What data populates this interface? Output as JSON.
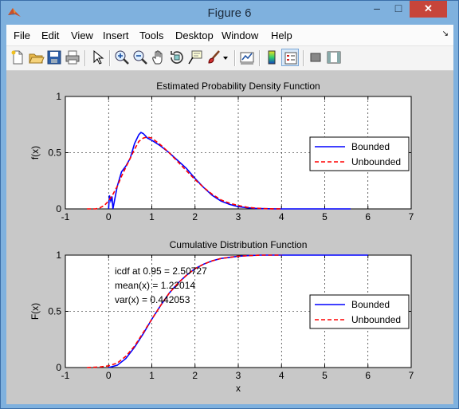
{
  "window": {
    "title": "Figure 6",
    "min_label": "–",
    "max_label": "□",
    "close_label": "✕"
  },
  "menu": [
    "File",
    "Edit",
    "View",
    "Insert",
    "Tools",
    "Desktop",
    "Window",
    "Help"
  ],
  "dock_glyph": "↘",
  "toolbar": [
    "new-figure-icon",
    "open-file-icon",
    "save-icon",
    "print-icon",
    "pointer-icon",
    "zoom-in-icon",
    "zoom-out-icon",
    "pan-icon",
    "rotate-3d-icon",
    "data-cursor-icon",
    "brush-icon",
    "brush-dropdown-icon",
    "link-plot-icon",
    "insert-colorbar-icon",
    "insert-legend-icon",
    "hide-plot-tools-icon",
    "show-plot-tools-icon"
  ],
  "chart_data": [
    {
      "type": "line",
      "title": "Estimated Probability Density Function",
      "xlabel": "",
      "ylabel": "f(x)",
      "xlim": [
        -1,
        7
      ],
      "ylim": [
        0,
        1
      ],
      "xticks": [
        "-1",
        "0",
        "1",
        "2",
        "3",
        "4",
        "5",
        "6",
        "7"
      ],
      "yticks": [
        "0",
        "0.5",
        "1"
      ],
      "grid": true,
      "legend_position": "right",
      "series": [
        {
          "name": "Bounded",
          "color": "#0000ff",
          "style": "solid",
          "x": [
            0.0,
            0.02,
            0.05,
            0.08,
            0.1,
            0.12,
            0.15,
            0.2,
            0.3,
            0.4,
            0.5,
            0.6,
            0.7,
            0.75,
            0.8,
            0.85,
            0.9,
            1.0,
            1.2,
            1.4,
            1.6,
            1.8,
            2.0,
            2.2,
            2.4,
            2.6,
            2.8,
            3.0,
            3.2,
            3.4,
            3.6,
            3.8,
            4.0,
            4.5,
            5.0,
            5.6
          ],
          "y": [
            0.0,
            0.12,
            0.07,
            0.11,
            0.0,
            0.04,
            0.1,
            0.2,
            0.33,
            0.38,
            0.45,
            0.58,
            0.66,
            0.68,
            0.67,
            0.65,
            0.63,
            0.61,
            0.56,
            0.5,
            0.43,
            0.36,
            0.27,
            0.19,
            0.12,
            0.07,
            0.04,
            0.02,
            0.01,
            0.005,
            0.002,
            0.001,
            0.0,
            0.0,
            0.0,
            0.0
          ]
        },
        {
          "name": "Unbounded",
          "color": "#ff0000",
          "style": "dashed",
          "x": [
            -0.5,
            -0.3,
            -0.2,
            -0.1,
            0.0,
            0.1,
            0.2,
            0.3,
            0.4,
            0.5,
            0.6,
            0.7,
            0.8,
            0.9,
            1.0,
            1.2,
            1.4,
            1.6,
            1.8,
            2.0,
            2.2,
            2.4,
            2.6,
            2.8,
            3.0,
            3.2,
            3.4,
            3.6,
            3.8,
            4.0
          ],
          "y": [
            0.0,
            0.0,
            0.01,
            0.03,
            0.07,
            0.13,
            0.2,
            0.29,
            0.37,
            0.45,
            0.53,
            0.6,
            0.63,
            0.64,
            0.63,
            0.57,
            0.5,
            0.42,
            0.34,
            0.26,
            0.19,
            0.13,
            0.08,
            0.05,
            0.03,
            0.015,
            0.007,
            0.003,
            0.001,
            0.0
          ]
        }
      ]
    },
    {
      "type": "line",
      "title": "Cumulative Distribution Function",
      "xlabel": "x",
      "ylabel": "F(x)",
      "xlim": [
        -1,
        7
      ],
      "ylim": [
        0,
        1
      ],
      "xticks": [
        "-1",
        "0",
        "1",
        "2",
        "3",
        "4",
        "5",
        "6",
        "7"
      ],
      "yticks": [
        "0",
        "0.5",
        "1"
      ],
      "grid": true,
      "legend_position": "right",
      "annotations": [
        "icdf at 0.95 = 2.50727",
        "mean(x) = 1.22014",
        "var(x) = 0.442053"
      ],
      "series": [
        {
          "name": "Bounded",
          "color": "#0000ff",
          "style": "solid",
          "x": [
            0.0,
            0.2,
            0.4,
            0.6,
            0.8,
            1.0,
            1.2,
            1.4,
            1.6,
            1.8,
            2.0,
            2.2,
            2.4,
            2.6,
            2.8,
            3.0,
            3.2,
            3.5,
            4.0,
            5.0,
            6.0
          ],
          "y": [
            0.0,
            0.02,
            0.08,
            0.18,
            0.3,
            0.43,
            0.55,
            0.66,
            0.75,
            0.82,
            0.88,
            0.92,
            0.95,
            0.97,
            0.98,
            0.99,
            0.995,
            1.0,
            1.0,
            1.0,
            1.0
          ]
        },
        {
          "name": "Unbounded",
          "color": "#ff0000",
          "style": "dashed",
          "x": [
            -0.5,
            -0.2,
            0.0,
            0.2,
            0.4,
            0.6,
            0.8,
            1.0,
            1.2,
            1.4,
            1.6,
            1.8,
            2.0,
            2.2,
            2.4,
            2.6,
            2.8,
            3.0,
            3.5,
            4.0
          ],
          "y": [
            0.0,
            0.005,
            0.015,
            0.04,
            0.1,
            0.19,
            0.31,
            0.43,
            0.55,
            0.66,
            0.75,
            0.82,
            0.88,
            0.92,
            0.95,
            0.97,
            0.98,
            0.99,
            1.0,
            1.0
          ]
        }
      ]
    }
  ]
}
